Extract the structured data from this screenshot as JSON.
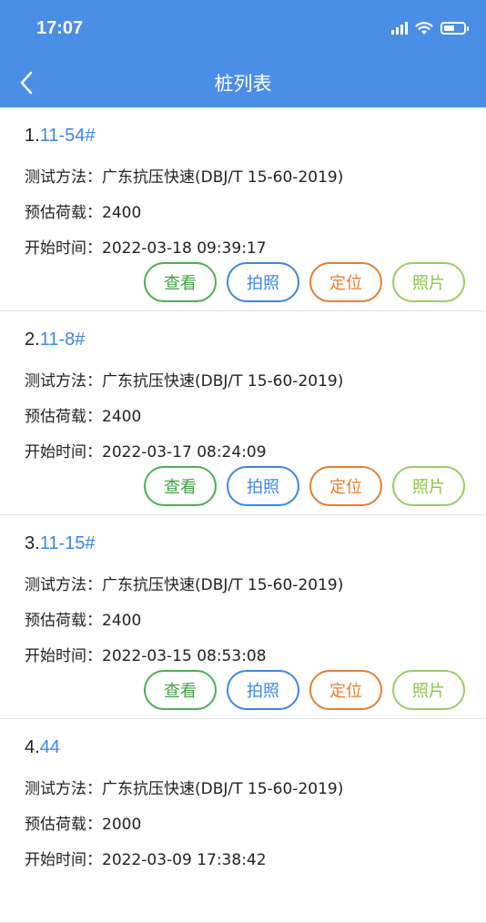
{
  "status_bar": {
    "time": "17:07"
  },
  "nav": {
    "title": "桩列表"
  },
  "labels": {
    "method": "测试方法：",
    "load": "预估荷载：",
    "start": "开始时间：",
    "view": "查看",
    "photo": "拍照",
    "locate": "定位",
    "pics": "照片"
  },
  "items": [
    {
      "index": "1.",
      "code": "11-54#",
      "method": "广东抗压快速(DBJ/T 15-60-2019)",
      "load": "2400",
      "start": "2022-03-18 09:39:17"
    },
    {
      "index": "2.",
      "code": "11-8#",
      "method": "广东抗压快速(DBJ/T 15-60-2019)",
      "load": "2400",
      "start": "2022-03-17 08:24:09"
    },
    {
      "index": "3.",
      "code": "11-15#",
      "method": "广东抗压快速(DBJ/T 15-60-2019)",
      "load": "2400",
      "start": "2022-03-15 08:53:08"
    },
    {
      "index": "4.",
      "code": "44",
      "method": "广东抗压快速(DBJ/T 15-60-2019)",
      "load": "2000",
      "start": "2022-03-09 17:38:42"
    }
  ]
}
